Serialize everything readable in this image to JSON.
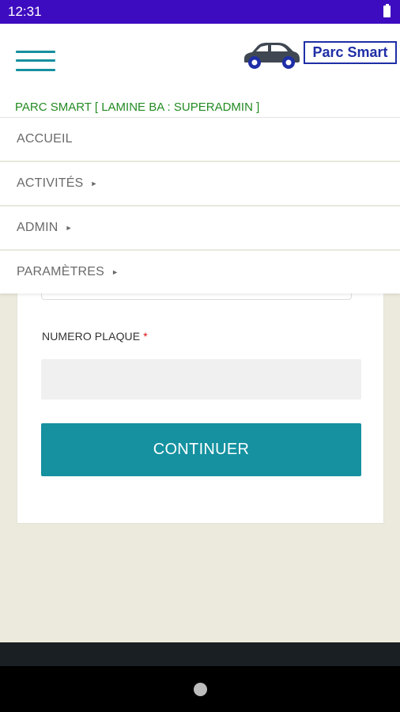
{
  "status_bar": {
    "time": "12:31",
    "battery_icon": "battery-full-icon"
  },
  "header": {
    "menu_icon": "hamburger-menu-icon",
    "logo_icon": "car-icon",
    "brand": "Parc Smart",
    "user_line": "PARC SMART [ LAMINE BA : SUPERADMIN ]"
  },
  "nav": {
    "items": [
      {
        "label": "ACCUEIL",
        "caret": ""
      },
      {
        "label": "ACTIVITÉS",
        "caret": "►"
      },
      {
        "label": "ADMIN",
        "caret": "►"
      },
      {
        "label": "PARAMÈTRES",
        "caret": "►"
      }
    ]
  },
  "form": {
    "plate_label": "NUMERO PLAQUE",
    "required_mark": "*",
    "plate_value": "",
    "continue_label": "CONTINUER"
  },
  "colors": {
    "status_bar": "#3e0cc0",
    "accent": "#1591a0",
    "brand": "#1f2ea6",
    "user_line": "#238b23",
    "background": "#ebeadd"
  },
  "system_nav": {
    "home_icon": "home-button-icon"
  }
}
